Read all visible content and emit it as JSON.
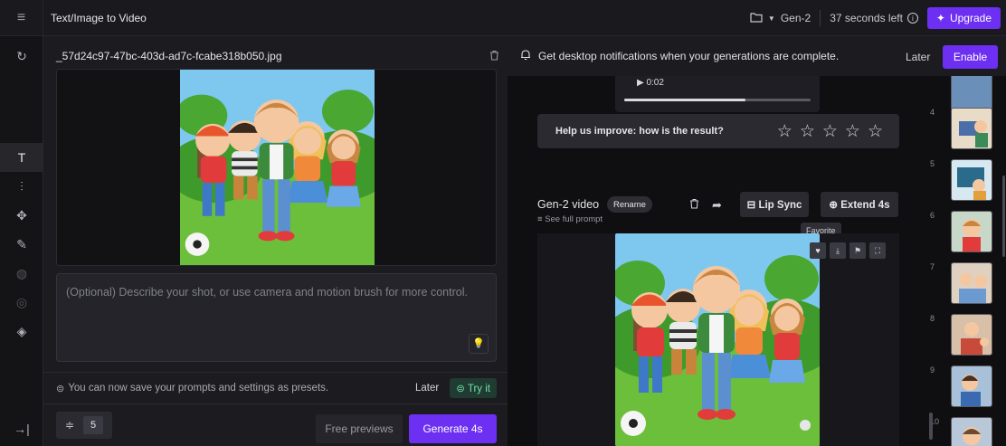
{
  "topbar": {
    "title": "Text/Image to Video",
    "model": "Gen-2",
    "time_left": "37 seconds left",
    "upgrade_label": "Upgrade"
  },
  "left": {
    "file_name": "_57d24c97-47bc-403d-ad7c-fcabe318b050.jpg",
    "prompt_placeholder": "(Optional) Describe your shot, or use camera and motion brush for more control.",
    "preset_text": "You can now save your prompts and settings as presets.",
    "preset_later": "Later",
    "preset_try": "Try it",
    "count": "5",
    "free_previews": "Free previews",
    "generate": "Generate 4s"
  },
  "right": {
    "notification": "Get desktop notifications when your generations are complete.",
    "notif_later": "Later",
    "notif_enable": "Enable",
    "video_time": "0:02",
    "feedback": "Help us improve: how is the result?",
    "rating": 0,
    "gen_title": "Gen-2 video",
    "rename": "Rename",
    "see_prompt": "See full prompt",
    "lip_sync": "Lip Sync",
    "extend": "Extend 4s",
    "tooltip": "Favorite"
  },
  "thumbs": [
    "4",
    "5",
    "6",
    "7",
    "8",
    "9",
    "10"
  ],
  "colors": {
    "accent": "#6d2ff2",
    "try_green": "#6ee0a8"
  }
}
